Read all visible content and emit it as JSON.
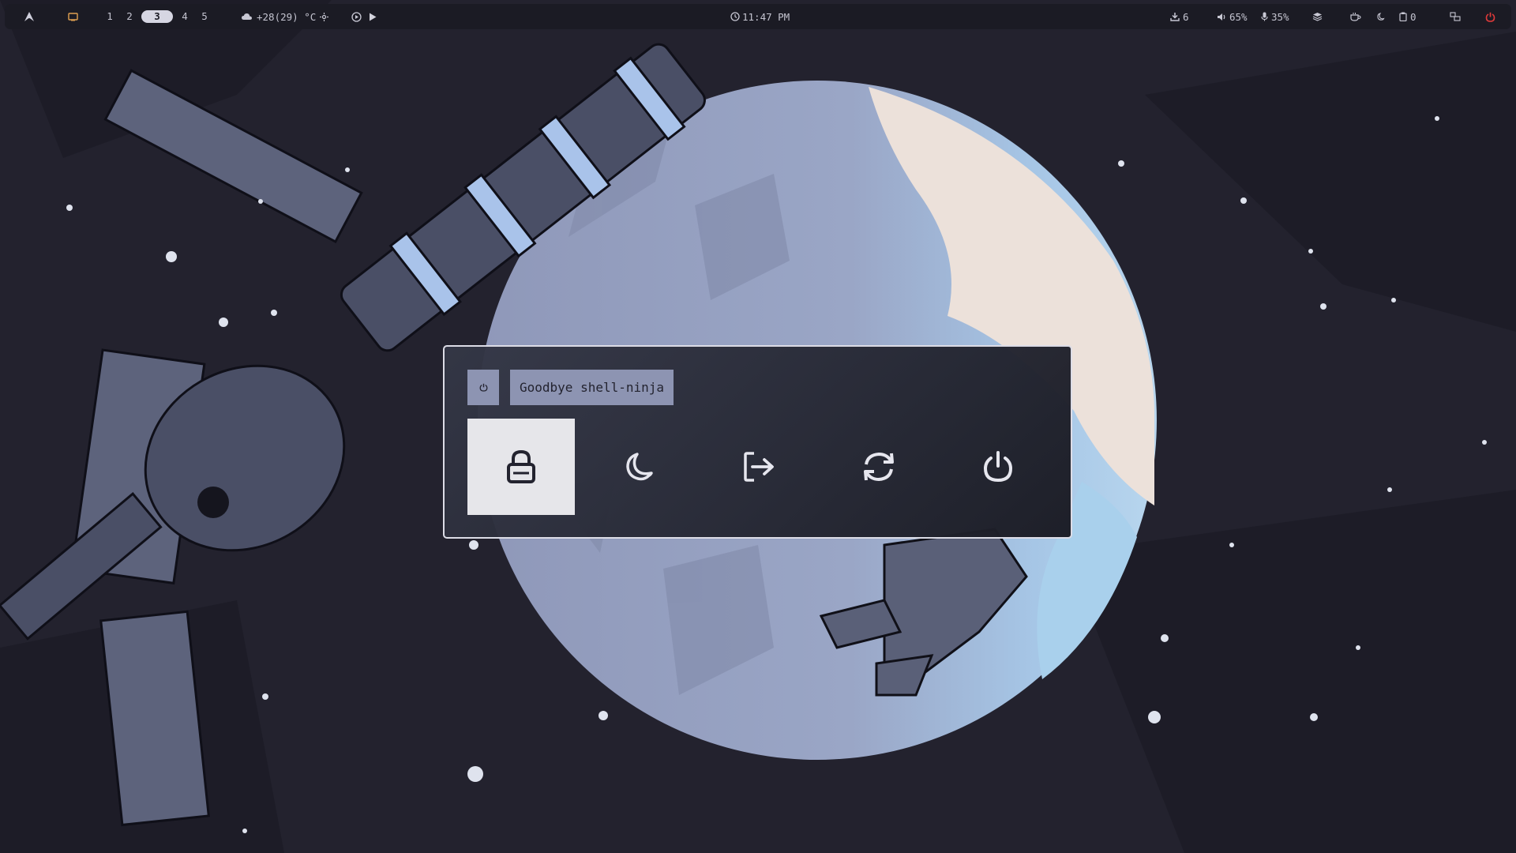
{
  "topbar": {
    "launcher_icon": "arch-logo-icon",
    "window_indicator_icon": "window-icon",
    "workspaces": [
      "1",
      "2",
      "3",
      "4",
      "5"
    ],
    "active_workspace": "3",
    "weather": "+28(29) °C",
    "weather_icon": "cloud-icon",
    "weather_extra_icon": "sun-icon",
    "media_icons": [
      "media-circle-play-icon",
      "play-icon"
    ],
    "clock": "11:47 PM",
    "clock_icon": "clock-icon",
    "updates": "6",
    "updates_icon": "download-icon",
    "volume": "65%",
    "volume_icon": "speaker-icon",
    "mic": "35%",
    "mic_icon": "microphone-icon",
    "layers_icon": "layers-icon",
    "idle_icon": "coffee-icon",
    "night_icon": "moon-icon",
    "clipboard": "0",
    "clipboard_icon": "clipboard-icon",
    "display_icon": "monitor-layout-icon",
    "power_icon": "power-icon",
    "accent_color": "#e03a3a"
  },
  "power_menu": {
    "title": "Goodbye shell-ninja",
    "title_icon": "power-icon",
    "options": [
      {
        "name": "lock",
        "icon": "lock-icon",
        "selected": true
      },
      {
        "name": "suspend",
        "icon": "moon-icon",
        "selected": false
      },
      {
        "name": "logout",
        "icon": "logout-icon",
        "selected": false
      },
      {
        "name": "reboot",
        "icon": "reboot-icon",
        "selected": false
      },
      {
        "name": "shutdown",
        "icon": "power-icon",
        "selected": false
      }
    ]
  }
}
